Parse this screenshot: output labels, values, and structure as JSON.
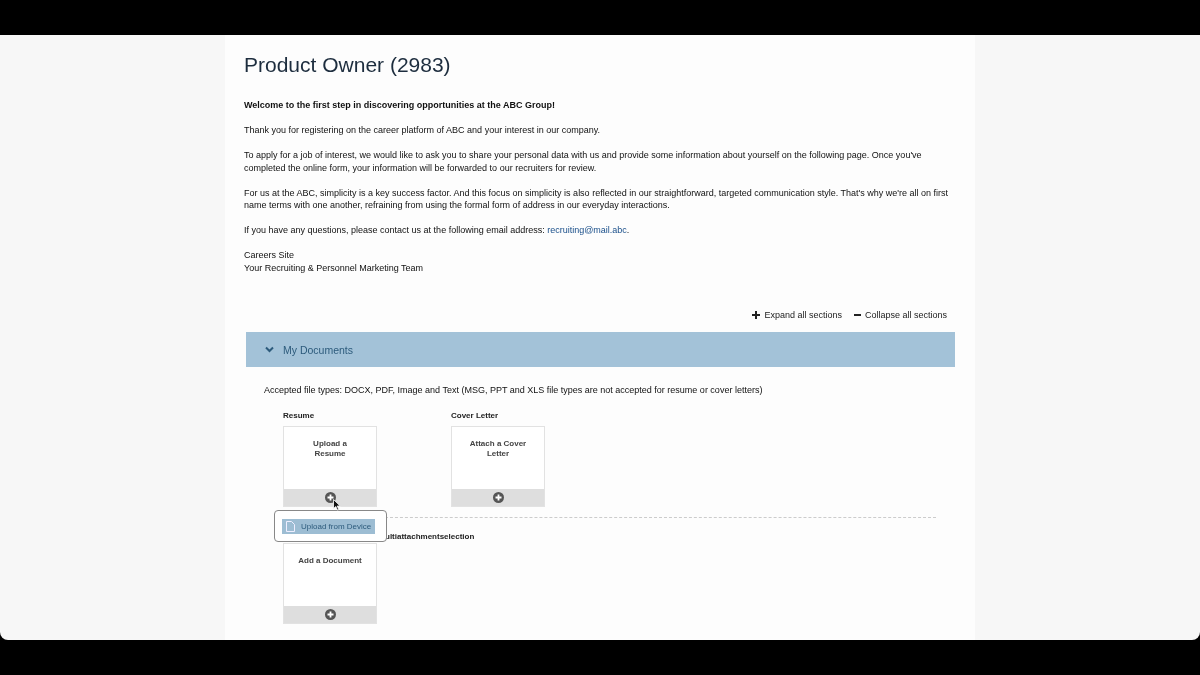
{
  "title": "Product Owner (2983)",
  "intro": [
    {
      "kind": "bold",
      "text": "Welcome to the first step in discovering opportunities at the ABC Group!"
    },
    {
      "kind": "text",
      "text": "Thank you for registering on the career platform of ABC and your interest in our company."
    },
    {
      "kind": "text",
      "text": "To apply for a job of interest, we would like to ask you to share your personal data with us and provide some information about yourself on the following page. Once you've completed the online form, your information will be forwarded to our recruiters for review."
    },
    {
      "kind": "text",
      "text": "For us at the ABC, simplicity is a key success factor. And this focus on simplicity is also reflected in our straightforward, targeted communication style. That's why we're all on first name terms with one another, refraining from using the formal form of address in our everyday interactions."
    },
    {
      "kind": "contact",
      "text": "If you have any questions, please contact us at the following email address:",
      "link": "recruiting@mail.abc",
      "after": "."
    }
  ],
  "signature": [
    "Careers Site",
    "Your Recruiting & Personnel Marketing Team"
  ],
  "section_controls": {
    "expand": "Expand all sections",
    "collapse": "Collapse all sections"
  },
  "section": {
    "title": "My Documents",
    "expanded": true
  },
  "accepted_types": "Accepted file types: DOCX, PDF, Image and Text (MSG, PPT and XLS file types are not accepted for resume or cover letters)",
  "uploads": [
    {
      "label": "Resume",
      "card_text": "Upload a Resume"
    },
    {
      "label": "Cover Letter",
      "card_text": "Attach a Cover Letter"
    }
  ],
  "popup": {
    "items": [
      {
        "label": "Upload from Device",
        "selected": true
      }
    ]
  },
  "additional": {
    "label": "ultiattachmentselection",
    "card_text": "Add a Document"
  }
}
